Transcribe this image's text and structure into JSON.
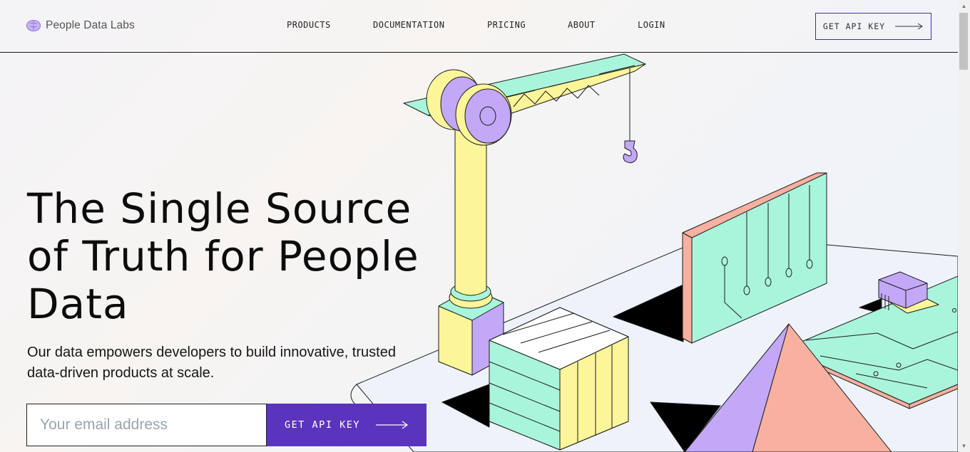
{
  "header": {
    "brand": "People Data Labs",
    "nav": [
      "PRODUCTS",
      "DOCUMENTATION",
      "PRICING",
      "ABOUT",
      "LOGIN"
    ],
    "cta_label": "GET API KEY"
  },
  "hero": {
    "title": "The Single Source of Truth for People Data",
    "subtitle": "Our data empowers developers to build innovative, trusted data-driven products at scale.",
    "email_placeholder": "Your email address",
    "cta_label": "GET API KEY"
  },
  "colors": {
    "accent": "#5b34bd",
    "mint": "#a9f5dc",
    "yellow": "#fdf59a",
    "lavender": "#c3a8f8",
    "salmon": "#f8b0a0"
  },
  "icons": [
    "brain-logo-icon",
    "arrow-right-icon",
    "scrollbar-arrow-icon"
  ]
}
